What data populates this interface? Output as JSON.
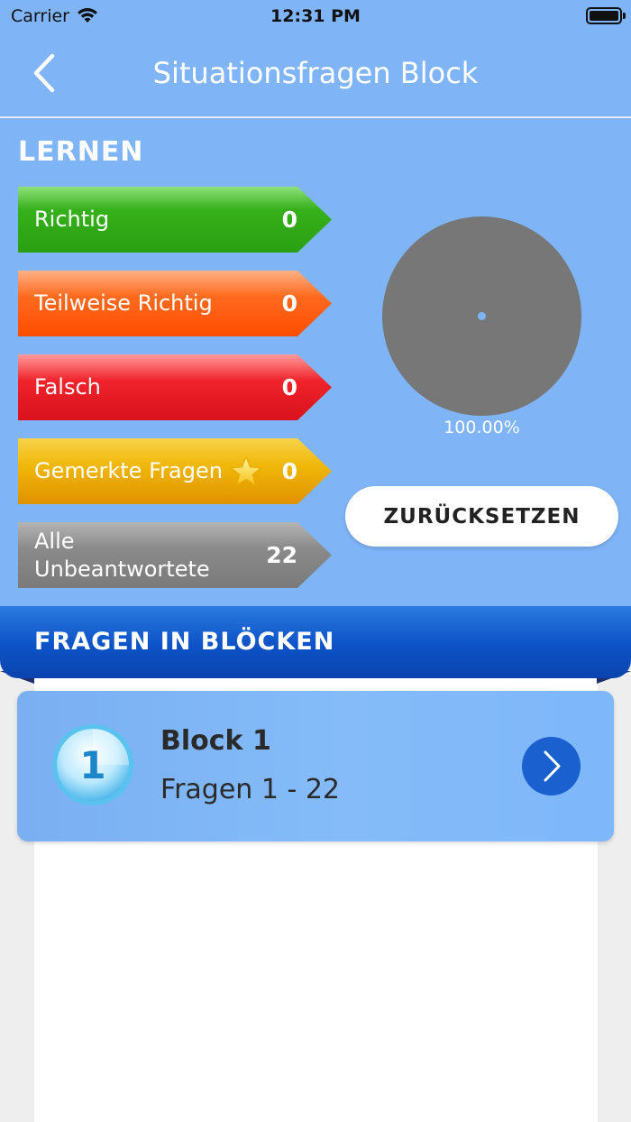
{
  "statusbar": {
    "carrier": "Carrier",
    "time": "12:31 PM",
    "wifi_icon": "wifi-icon",
    "battery_icon": "battery-icon"
  },
  "navbar": {
    "title": "Situationsfragen Block",
    "back_icon": "chevron-left-icon"
  },
  "learn": {
    "heading": "LERNEN",
    "categories": [
      {
        "label": "Richtig",
        "count": "0",
        "color": "#2aa012"
      },
      {
        "label": "Teilweise Richtig",
        "count": "0",
        "color": "#ff4d00"
      },
      {
        "label": "Falsch",
        "count": "0",
        "color": "#d8121c"
      },
      {
        "label": "Gemerkte Fragen",
        "count": "0",
        "color": "#e09200",
        "icon": "star-icon"
      },
      {
        "label": "Alle\nUnbeantwortete",
        "count": "22",
        "color": "#7a7a7a"
      }
    ],
    "chart": {
      "percent_label": "100.00%",
      "percent_value": 100,
      "color": "#777777"
    },
    "reset_label": "ZURÜCKSETZEN"
  },
  "blocks_section": {
    "heading": "FRAGEN IN BLÖCKEN",
    "items": [
      {
        "number": "1",
        "title": "Block 1",
        "subtitle": "Fragen 1 - 22",
        "icon": "chevron-right-icon"
      }
    ]
  },
  "colors": {
    "primary_bg": "#7fb4f7",
    "ribbon": "#0d52c6",
    "button_accent": "#1a60cf"
  }
}
